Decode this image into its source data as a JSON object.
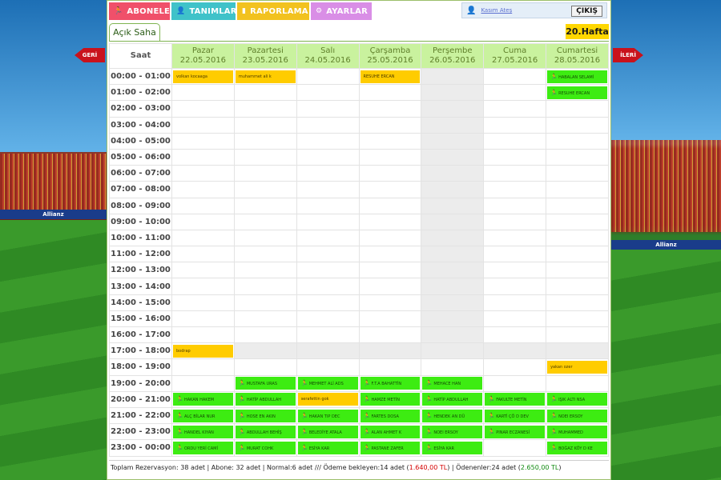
{
  "nav": {
    "items": [
      {
        "label": "ABONELER",
        "icon": "runner-icon"
      },
      {
        "label": "TANIMLAR",
        "icon": "person-icon"
      },
      {
        "label": "RAPORLAMA",
        "icon": "bar-chart-icon"
      },
      {
        "label": "AYARLAR",
        "icon": "gear-icon"
      }
    ],
    "user_name": "Kasım Ateş",
    "exit_label": "ÇIKIŞ"
  },
  "field_tab": "Açık Saha",
  "week_label": "20.Hafta",
  "prev_label": "GERİ",
  "next_label": "İLERİ",
  "schedule": {
    "time_header": "Saat",
    "days": [
      {
        "name": "Pazar",
        "date": "22.05.2016"
      },
      {
        "name": "Pazartesi",
        "date": "23.05.2016"
      },
      {
        "name": "Salı",
        "date": "24.05.2016"
      },
      {
        "name": "Çarşamba",
        "date": "25.05.2016"
      },
      {
        "name": "Perşembe",
        "date": "26.05.2016"
      },
      {
        "name": "Cuma",
        "date": "27.05.2016"
      },
      {
        "name": "Cumartesi",
        "date": "28.05.2016"
      }
    ],
    "times": [
      "00:00 - 01:00",
      "01:00 - 02:00",
      "02:00 - 03:00",
      "03:00 - 04:00",
      "04:00 - 05:00",
      "05:00 - 06:00",
      "06:00 - 07:00",
      "07:00 - 08:00",
      "08:00 - 09:00",
      "09:00 - 10:00",
      "10:00 - 11:00",
      "11:00 - 12:00",
      "12:00 - 13:00",
      "13:00 - 14:00",
      "14:00 - 15:00",
      "15:00 - 16:00",
      "16:00 - 17:00",
      "17:00 - 18:00",
      "18:00 - 19:00",
      "19:00 - 20:00",
      "20:00 - 21:00",
      "21:00 - 22:00",
      "22:00 - 23:00",
      "23:00 - 00:00"
    ],
    "reservations": [
      {
        "row": 0,
        "day": 0,
        "type": "normal",
        "name": "volkan kocaaga"
      },
      {
        "row": 0,
        "day": 1,
        "type": "normal",
        "name": "muhammet ali k"
      },
      {
        "row": 0,
        "day": 3,
        "type": "normal",
        "name": "RESUHE ERCAN"
      },
      {
        "row": 0,
        "day": 6,
        "type": "subscriber",
        "name": "HABALAN SELAMİ"
      },
      {
        "row": 1,
        "day": 6,
        "type": "subscriber",
        "name": "RESUHE ERCAN"
      },
      {
        "row": 17,
        "day": 0,
        "type": "normal",
        "name": "bodrap"
      },
      {
        "row": 18,
        "day": 6,
        "type": "normal",
        "name": "yakan ozer"
      },
      {
        "row": 19,
        "day": 1,
        "type": "subscriber",
        "name": "MUSTAFA URAS"
      },
      {
        "row": 19,
        "day": 2,
        "type": "subscriber",
        "name": "MEHMET ALİ ADS"
      },
      {
        "row": 19,
        "day": 3,
        "type": "subscriber",
        "name": "F.T.A BAHATTİN"
      },
      {
        "row": 19,
        "day": 4,
        "type": "subscriber",
        "name": "MEHACE HAN"
      },
      {
        "row": 20,
        "day": 0,
        "type": "subscriber",
        "name": "HAKAN HAKEM"
      },
      {
        "row": 20,
        "day": 1,
        "type": "subscriber",
        "name": "HATİP ABDULLAH"
      },
      {
        "row": 20,
        "day": 2,
        "type": "normal",
        "name": "serafettin gok"
      },
      {
        "row": 20,
        "day": 3,
        "type": "subscriber",
        "name": "HAMZE METİN"
      },
      {
        "row": 20,
        "day": 4,
        "type": "subscriber",
        "name": "HATİP ABDULLAH"
      },
      {
        "row": 20,
        "day": 5,
        "type": "subscriber",
        "name": "FAKULTE METİN"
      },
      {
        "row": 20,
        "day": 6,
        "type": "subscriber",
        "name": "IŞIK ALTI NSA"
      },
      {
        "row": 21,
        "day": 0,
        "type": "subscriber",
        "name": "ALÇ BİLAR NUR"
      },
      {
        "row": 21,
        "day": 1,
        "type": "subscriber",
        "name": "HOSE EN AKIN"
      },
      {
        "row": 21,
        "day": 2,
        "type": "subscriber",
        "name": "HAKAN TIP DEC"
      },
      {
        "row": 21,
        "day": 3,
        "type": "subscriber",
        "name": "FARTES DOSA"
      },
      {
        "row": 21,
        "day": 4,
        "type": "subscriber",
        "name": "HENDEK AN DÜ"
      },
      {
        "row": 21,
        "day": 5,
        "type": "subscriber",
        "name": "KARTİ ÇÖ D DEV"
      },
      {
        "row": 21,
        "day": 6,
        "type": "subscriber",
        "name": "NOEI ERSOY"
      },
      {
        "row": 22,
        "day": 0,
        "type": "subscriber",
        "name": "HANDEL KIYAN"
      },
      {
        "row": 22,
        "day": 1,
        "type": "subscriber",
        "name": "ABDULLAH BEHİŞ"
      },
      {
        "row": 22,
        "day": 2,
        "type": "subscriber",
        "name": "BELEDİYE ATALA"
      },
      {
        "row": 22,
        "day": 3,
        "type": "subscriber",
        "name": "ALAN AHMET K"
      },
      {
        "row": 22,
        "day": 4,
        "type": "subscriber",
        "name": "NOEI ERSOY"
      },
      {
        "row": 22,
        "day": 5,
        "type": "subscriber",
        "name": "PINAR ECZANESİ"
      },
      {
        "row": 22,
        "day": 6,
        "type": "subscriber",
        "name": "MUHAMMED"
      },
      {
        "row": 23,
        "day": 0,
        "type": "subscriber",
        "name": "ORDU YERİ CAMİ"
      },
      {
        "row": 23,
        "day": 1,
        "type": "subscriber",
        "name": "MURAT COHK"
      },
      {
        "row": 23,
        "day": 2,
        "type": "subscriber",
        "name": "ESİYA KAR"
      },
      {
        "row": 23,
        "day": 3,
        "type": "subscriber",
        "name": "PASTANE ZAFER"
      },
      {
        "row": 23,
        "day": 4,
        "type": "subscriber",
        "name": "ESİYA KAR"
      },
      {
        "row": 23,
        "day": 6,
        "type": "subscriber",
        "name": "BOĞAZ KÖY D KE"
      }
    ],
    "grey_cells": [
      {
        "row": 0,
        "day": 4
      },
      {
        "row": 1,
        "day": 4
      },
      {
        "row": 2,
        "day": 4
      },
      {
        "row": 3,
        "day": 4
      },
      {
        "row": 4,
        "day": 4
      },
      {
        "row": 5,
        "day": 4
      },
      {
        "row": 6,
        "day": 4
      },
      {
        "row": 7,
        "day": 4
      },
      {
        "row": 8,
        "day": 4
      },
      {
        "row": 9,
        "day": 4
      },
      {
        "row": 10,
        "day": 4
      },
      {
        "row": 11,
        "day": 4
      },
      {
        "row": 12,
        "day": 4
      },
      {
        "row": 13,
        "day": 4
      },
      {
        "row": 14,
        "day": 4
      },
      {
        "row": 15,
        "day": 4
      },
      {
        "row": 16,
        "day": 4
      },
      {
        "row": 17,
        "day": 1
      },
      {
        "row": 17,
        "day": 2
      },
      {
        "row": 17,
        "day": 3
      },
      {
        "row": 17,
        "day": 4
      },
      {
        "row": 17,
        "day": 5
      },
      {
        "row": 17,
        "day": 6
      }
    ]
  },
  "footer": {
    "part1": "Toplam Rezervasyon: 38 adet | Abone: 32 adet | Normal:6 adet /// Ödeme bekleyen:14 adet (",
    "pending_amount": "1.640,00 TL",
    "part2": ") | Ödenenler:24 adet (",
    "paid_amount": "2.650,00 TL",
    "part3": ")"
  },
  "colors": {
    "subscriber": "#3dec12",
    "normal": "#ffcc00",
    "header_bg": "#c9f29e",
    "nav_aboneler": "#f0506a",
    "nav_tanimlar": "#3fc2c9",
    "nav_raporlama": "#f2c21f",
    "nav_ayarlar": "#d98ee6"
  }
}
